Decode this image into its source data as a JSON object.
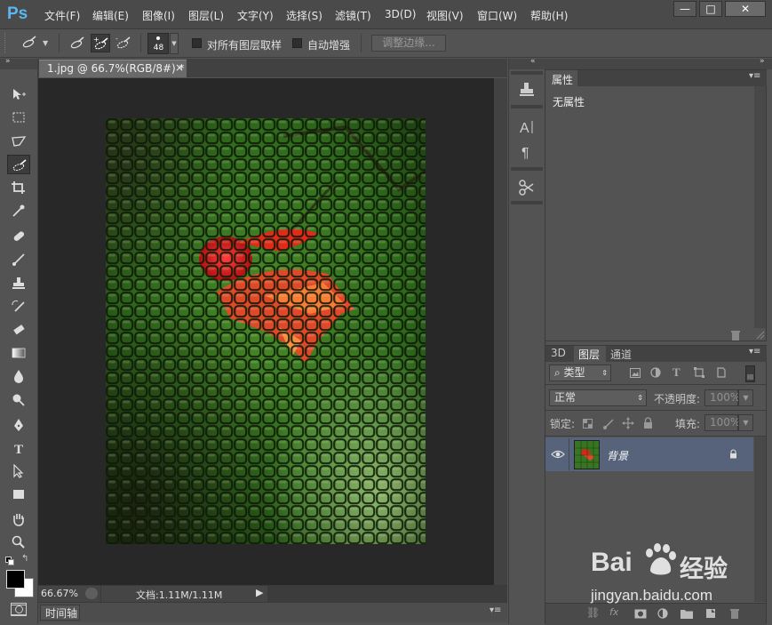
{
  "app": {
    "logo": "Ps"
  },
  "menu": [
    "文件(F)",
    "编辑(E)",
    "图像(I)",
    "图层(L)",
    "文字(Y)",
    "选择(S)",
    "滤镜(T)",
    "3D(D)",
    "视图(V)",
    "窗口(W)",
    "帮助(H)"
  ],
  "window_controls": {
    "minimize": "—",
    "maximize": "□",
    "close": "✕"
  },
  "options": {
    "brush_size": "48",
    "sample_all_layers_label": "对所有图层取样",
    "sample_all_layers_checked": false,
    "auto_enhance_label": "自动增强",
    "auto_enhance_checked": false,
    "refine_edge_label": "调整边缘..."
  },
  "document": {
    "tab_label": "1.jpg @ 66.7%(RGB/8#) *",
    "tab_close": "×",
    "zoom": "66.67%",
    "doc_info": "文档:1.11M/1.11M"
  },
  "timeline": {
    "label": "时间轴"
  },
  "properties": {
    "tab_label": "属性",
    "body_text": "无属性"
  },
  "layers_panel": {
    "tabs": [
      "3D",
      "图层",
      "通道"
    ],
    "active_tab": "图层",
    "filter_label": "类型",
    "blend_mode": "正常",
    "opacity_label": "不透明度:",
    "opacity_value": "100%",
    "lock_label": "锁定:",
    "fill_label": "填充:",
    "fill_value": "100%",
    "layers": [
      {
        "name": "背景",
        "visible": true,
        "locked": true
      }
    ]
  },
  "watermark": {
    "brand_latin": "Bai",
    "brand_cn": "经验",
    "url": "jingyan.baidu.com"
  },
  "colors": {
    "ps_logo": "#5ab6f2",
    "selected_layer": "#56637a",
    "canvas_bg": "#282828"
  },
  "tools": [
    "move-tool",
    "marquee-tool",
    "lasso-tool",
    "quick-selection-tool",
    "crop-tool",
    "eyedropper-tool",
    "healing-brush-tool",
    "brush-tool",
    "clone-stamp-tool",
    "history-brush-tool",
    "eraser-tool",
    "gradient-tool",
    "blur-tool",
    "dodge-tool",
    "pen-tool",
    "type-tool",
    "path-selection-tool",
    "rectangle-tool",
    "hand-tool",
    "zoom-tool"
  ]
}
